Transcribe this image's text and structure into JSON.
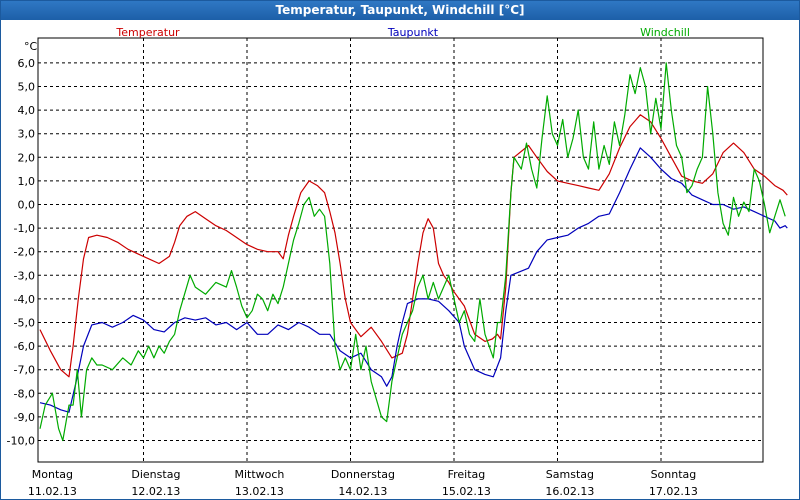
{
  "window": {
    "title": "Temperatur, Taupunkt, Windchill [°C]"
  },
  "chart_data": {
    "type": "line",
    "title": "Temperatur, Taupunkt, Windchill [°C]",
    "ylabel": "°C",
    "ylim": [
      -10.5,
      6.5
    ],
    "yticks": [
      "6,0",
      "5,0",
      "4,0",
      "3,0",
      "2,0",
      "1,0",
      "0,0",
      "-1,0",
      "-2,0",
      "-3,0",
      "-4,0",
      "-5,0",
      "-6,0",
      "-7,0",
      "-8,0",
      "-9,0",
      "-10,0"
    ],
    "ytick_values": [
      6,
      5,
      4,
      3,
      2,
      1,
      0,
      -1,
      -2,
      -3,
      -4,
      -5,
      -6,
      -7,
      -8,
      -9,
      -10
    ],
    "xlim": [
      0,
      7
    ],
    "x_unit": "days since 11.02.13 00:00",
    "day_labels": [
      {
        "weekday": "Montag",
        "date": "11.02.13"
      },
      {
        "weekday": "Dienstag",
        "date": "12.02.13"
      },
      {
        "weekday": "Mittwoch",
        "date": "13.02.13"
      },
      {
        "weekday": "Donnerstag",
        "date": "14.02.13"
      },
      {
        "weekday": "Freitag",
        "date": "15.02.13"
      },
      {
        "weekday": "Samstag",
        "date": "16.02.13"
      },
      {
        "weekday": "Sonntag",
        "date": "17.02.13"
      }
    ],
    "grid": true,
    "legend": "top",
    "series": [
      {
        "name": "Temperatur",
        "color": "#cc0000",
        "points": [
          [
            0.0,
            -5.3
          ],
          [
            0.1,
            -6.2
          ],
          [
            0.2,
            -7.0
          ],
          [
            0.28,
            -7.3
          ],
          [
            0.32,
            -6.0
          ],
          [
            0.37,
            -4.0
          ],
          [
            0.42,
            -2.3
          ],
          [
            0.47,
            -1.4
          ],
          [
            0.55,
            -1.3
          ],
          [
            0.65,
            -1.4
          ],
          [
            0.75,
            -1.6
          ],
          [
            0.85,
            -1.9
          ],
          [
            0.95,
            -2.1
          ],
          [
            1.05,
            -2.3
          ],
          [
            1.15,
            -2.5
          ],
          [
            1.25,
            -2.2
          ],
          [
            1.3,
            -1.6
          ],
          [
            1.35,
            -0.9
          ],
          [
            1.42,
            -0.5
          ],
          [
            1.5,
            -0.3
          ],
          [
            1.6,
            -0.6
          ],
          [
            1.7,
            -0.9
          ],
          [
            1.8,
            -1.1
          ],
          [
            1.9,
            -1.4
          ],
          [
            2.0,
            -1.7
          ],
          [
            2.1,
            -1.9
          ],
          [
            2.2,
            -2.0
          ],
          [
            2.3,
            -2.0
          ],
          [
            2.35,
            -2.3
          ],
          [
            2.4,
            -1.3
          ],
          [
            2.45,
            -0.5
          ],
          [
            2.52,
            0.5
          ],
          [
            2.6,
            1.0
          ],
          [
            2.68,
            0.8
          ],
          [
            2.75,
            0.5
          ],
          [
            2.8,
            -0.3
          ],
          [
            2.85,
            -1.2
          ],
          [
            2.9,
            -2.5
          ],
          [
            2.95,
            -4.0
          ],
          [
            3.0,
            -5.0
          ],
          [
            3.1,
            -5.6
          ],
          [
            3.2,
            -5.2
          ],
          [
            3.3,
            -5.8
          ],
          [
            3.4,
            -6.5
          ],
          [
            3.5,
            -6.3
          ],
          [
            3.55,
            -5.5
          ],
          [
            3.6,
            -4.0
          ],
          [
            3.65,
            -2.5
          ],
          [
            3.7,
            -1.2
          ],
          [
            3.75,
            -0.6
          ],
          [
            3.8,
            -1.0
          ],
          [
            3.85,
            -2.5
          ],
          [
            3.9,
            -3.0
          ],
          [
            3.95,
            -3.3
          ],
          [
            4.0,
            -3.7
          ],
          [
            4.1,
            -4.3
          ],
          [
            4.2,
            -5.5
          ],
          [
            4.3,
            -5.8
          ],
          [
            4.37,
            -5.7
          ],
          [
            4.42,
            -5.5
          ],
          [
            4.45,
            -5.7
          ],
          [
            4.5,
            -3.5
          ],
          [
            4.55,
            0.5
          ],
          [
            4.58,
            2.0
          ],
          [
            4.72,
            2.5
          ],
          [
            4.8,
            2.0
          ],
          [
            4.9,
            1.4
          ],
          [
            5.0,
            1.0
          ],
          [
            5.1,
            0.9
          ],
          [
            5.2,
            0.8
          ],
          [
            5.3,
            0.7
          ],
          [
            5.4,
            0.6
          ],
          [
            5.5,
            1.3
          ],
          [
            5.6,
            2.4
          ],
          [
            5.7,
            3.3
          ],
          [
            5.8,
            3.8
          ],
          [
            5.9,
            3.5
          ],
          [
            6.0,
            2.8
          ],
          [
            6.1,
            2.0
          ],
          [
            6.2,
            1.2
          ],
          [
            6.3,
            1.0
          ],
          [
            6.4,
            0.9
          ],
          [
            6.5,
            1.3
          ],
          [
            6.6,
            2.2
          ],
          [
            6.7,
            2.6
          ],
          [
            6.8,
            2.2
          ],
          [
            6.9,
            1.5
          ],
          [
            7.0,
            1.2
          ],
          [
            7.1,
            0.8
          ],
          [
            7.18,
            0.6
          ],
          [
            7.22,
            0.4
          ]
        ]
      },
      {
        "name": "Taupunkt",
        "color": "#0000bb",
        "points": [
          [
            0.0,
            -8.4
          ],
          [
            0.1,
            -8.5
          ],
          [
            0.2,
            -8.7
          ],
          [
            0.28,
            -8.8
          ],
          [
            0.35,
            -7.5
          ],
          [
            0.42,
            -6.0
          ],
          [
            0.5,
            -5.1
          ],
          [
            0.6,
            -5.0
          ],
          [
            0.7,
            -5.2
          ],
          [
            0.8,
            -5.0
          ],
          [
            0.9,
            -4.7
          ],
          [
            1.0,
            -4.9
          ],
          [
            1.1,
            -5.3
          ],
          [
            1.2,
            -5.4
          ],
          [
            1.3,
            -5.0
          ],
          [
            1.4,
            -4.8
          ],
          [
            1.5,
            -4.9
          ],
          [
            1.6,
            -4.8
          ],
          [
            1.7,
            -5.1
          ],
          [
            1.8,
            -5.0
          ],
          [
            1.9,
            -5.3
          ],
          [
            2.0,
            -5.0
          ],
          [
            2.1,
            -5.5
          ],
          [
            2.2,
            -5.5
          ],
          [
            2.3,
            -5.1
          ],
          [
            2.4,
            -5.3
          ],
          [
            2.5,
            -5.0
          ],
          [
            2.6,
            -5.2
          ],
          [
            2.7,
            -5.5
          ],
          [
            2.8,
            -5.5
          ],
          [
            2.9,
            -6.2
          ],
          [
            3.0,
            -6.5
          ],
          [
            3.1,
            -6.3
          ],
          [
            3.2,
            -7.0
          ],
          [
            3.3,
            -7.3
          ],
          [
            3.35,
            -7.7
          ],
          [
            3.4,
            -7.3
          ],
          [
            3.45,
            -6.0
          ],
          [
            3.5,
            -5.0
          ],
          [
            3.55,
            -4.2
          ],
          [
            3.65,
            -4.0
          ],
          [
            3.75,
            -4.0
          ],
          [
            3.85,
            -4.1
          ],
          [
            3.95,
            -4.5
          ],
          [
            4.05,
            -5.0
          ],
          [
            4.1,
            -6.0
          ],
          [
            4.2,
            -7.0
          ],
          [
            4.3,
            -7.2
          ],
          [
            4.38,
            -7.3
          ],
          [
            4.45,
            -6.5
          ],
          [
            4.5,
            -4.5
          ],
          [
            4.55,
            -3.0
          ],
          [
            4.72,
            -2.7
          ],
          [
            4.8,
            -2.0
          ],
          [
            4.9,
            -1.5
          ],
          [
            5.0,
            -1.4
          ],
          [
            5.1,
            -1.3
          ],
          [
            5.2,
            -1.0
          ],
          [
            5.3,
            -0.8
          ],
          [
            5.4,
            -0.5
          ],
          [
            5.5,
            -0.4
          ],
          [
            5.6,
            0.5
          ],
          [
            5.7,
            1.5
          ],
          [
            5.8,
            2.4
          ],
          [
            5.9,
            2.0
          ],
          [
            6.0,
            1.5
          ],
          [
            6.1,
            1.1
          ],
          [
            6.2,
            0.9
          ],
          [
            6.3,
            0.4
          ],
          [
            6.4,
            0.2
          ],
          [
            6.5,
            0.0
          ],
          [
            6.6,
            0.0
          ],
          [
            6.7,
            -0.2
          ],
          [
            6.8,
            -0.1
          ],
          [
            6.9,
            -0.3
          ],
          [
            7.0,
            -0.5
          ],
          [
            7.1,
            -0.7
          ],
          [
            7.15,
            -1.0
          ],
          [
            7.2,
            -0.9
          ],
          [
            7.22,
            -1.0
          ]
        ]
      },
      {
        "name": "Windchill",
        "color": "#00aa00",
        "points": [
          [
            0.0,
            -9.5
          ],
          [
            0.05,
            -8.5
          ],
          [
            0.12,
            -8.0
          ],
          [
            0.18,
            -9.5
          ],
          [
            0.22,
            -10.0
          ],
          [
            0.28,
            -8.5
          ],
          [
            0.32,
            -8.5
          ],
          [
            0.36,
            -7.0
          ],
          [
            0.4,
            -9.0
          ],
          [
            0.45,
            -7.0
          ],
          [
            0.5,
            -6.5
          ],
          [
            0.55,
            -6.8
          ],
          [
            0.6,
            -6.8
          ],
          [
            0.7,
            -7.0
          ],
          [
            0.8,
            -6.5
          ],
          [
            0.88,
            -6.8
          ],
          [
            0.95,
            -6.2
          ],
          [
            1.0,
            -6.5
          ],
          [
            1.05,
            -6.0
          ],
          [
            1.1,
            -6.5
          ],
          [
            1.15,
            -6.0
          ],
          [
            1.2,
            -6.3
          ],
          [
            1.25,
            -5.8
          ],
          [
            1.3,
            -5.5
          ],
          [
            1.35,
            -4.5
          ],
          [
            1.45,
            -3.0
          ],
          [
            1.5,
            -3.5
          ],
          [
            1.6,
            -3.8
          ],
          [
            1.7,
            -3.3
          ],
          [
            1.8,
            -3.5
          ],
          [
            1.85,
            -2.8
          ],
          [
            1.9,
            -3.5
          ],
          [
            1.95,
            -4.3
          ],
          [
            2.0,
            -4.8
          ],
          [
            2.05,
            -4.5
          ],
          [
            2.1,
            -3.8
          ],
          [
            2.15,
            -4.0
          ],
          [
            2.2,
            -4.5
          ],
          [
            2.25,
            -3.8
          ],
          [
            2.3,
            -4.2
          ],
          [
            2.35,
            -3.5
          ],
          [
            2.4,
            -2.5
          ],
          [
            2.45,
            -1.5
          ],
          [
            2.5,
            -0.8
          ],
          [
            2.55,
            0.0
          ],
          [
            2.6,
            0.3
          ],
          [
            2.65,
            -0.5
          ],
          [
            2.7,
            -0.2
          ],
          [
            2.75,
            -0.5
          ],
          [
            2.8,
            -2.5
          ],
          [
            2.85,
            -6.0
          ],
          [
            2.9,
            -7.0
          ],
          [
            2.95,
            -6.5
          ],
          [
            3.0,
            -7.0
          ],
          [
            3.05,
            -5.5
          ],
          [
            3.1,
            -7.0
          ],
          [
            3.15,
            -6.0
          ],
          [
            3.2,
            -7.5
          ],
          [
            3.3,
            -9.0
          ],
          [
            3.35,
            -9.2
          ],
          [
            3.4,
            -7.5
          ],
          [
            3.5,
            -5.5
          ],
          [
            3.6,
            -4.5
          ],
          [
            3.65,
            -3.5
          ],
          [
            3.7,
            -3.0
          ],
          [
            3.75,
            -4.0
          ],
          [
            3.8,
            -3.3
          ],
          [
            3.85,
            -4.0
          ],
          [
            3.9,
            -3.5
          ],
          [
            3.95,
            -3.0
          ],
          [
            4.0,
            -4.0
          ],
          [
            4.05,
            -5.0
          ],
          [
            4.1,
            -4.5
          ],
          [
            4.15,
            -5.5
          ],
          [
            4.2,
            -5.8
          ],
          [
            4.25,
            -4.0
          ],
          [
            4.3,
            -5.5
          ],
          [
            4.38,
            -6.5
          ],
          [
            4.42,
            -5.0
          ],
          [
            4.45,
            -5.0
          ],
          [
            4.5,
            -3.0
          ],
          [
            4.55,
            0.5
          ],
          [
            4.58,
            2.0
          ],
          [
            4.65,
            1.5
          ],
          [
            4.7,
            2.6
          ],
          [
            4.75,
            1.5
          ],
          [
            4.8,
            0.7
          ],
          [
            4.85,
            2.8
          ],
          [
            4.9,
            4.6
          ],
          [
            4.95,
            3.0
          ],
          [
            5.0,
            2.5
          ],
          [
            5.05,
            3.6
          ],
          [
            5.1,
            2.0
          ],
          [
            5.15,
            2.8
          ],
          [
            5.2,
            4.0
          ],
          [
            5.25,
            2.0
          ],
          [
            5.3,
            1.5
          ],
          [
            5.35,
            3.5
          ],
          [
            5.4,
            1.5
          ],
          [
            5.45,
            2.5
          ],
          [
            5.5,
            1.7
          ],
          [
            5.55,
            3.5
          ],
          [
            5.6,
            2.5
          ],
          [
            5.65,
            3.8
          ],
          [
            5.7,
            5.5
          ],
          [
            5.75,
            4.7
          ],
          [
            5.8,
            5.8
          ],
          [
            5.85,
            5.0
          ],
          [
            5.9,
            3.0
          ],
          [
            5.95,
            4.5
          ],
          [
            6.0,
            3.2
          ],
          [
            6.05,
            6.0
          ],
          [
            6.1,
            4.0
          ],
          [
            6.15,
            2.5
          ],
          [
            6.2,
            2.0
          ],
          [
            6.25,
            0.5
          ],
          [
            6.3,
            0.8
          ],
          [
            6.35,
            1.5
          ],
          [
            6.4,
            2.0
          ],
          [
            6.45,
            5.0
          ],
          [
            6.5,
            3.0
          ],
          [
            6.55,
            0.5
          ],
          [
            6.6,
            -0.8
          ],
          [
            6.65,
            -1.3
          ],
          [
            6.7,
            0.3
          ],
          [
            6.75,
            -0.5
          ],
          [
            6.8,
            0.1
          ],
          [
            6.85,
            -0.3
          ],
          [
            6.9,
            1.5
          ],
          [
            6.95,
            1.0
          ],
          [
            7.0,
            0.0
          ],
          [
            7.05,
            -1.2
          ],
          [
            7.1,
            -0.5
          ],
          [
            7.15,
            0.2
          ],
          [
            7.2,
            -0.5
          ]
        ]
      }
    ]
  }
}
